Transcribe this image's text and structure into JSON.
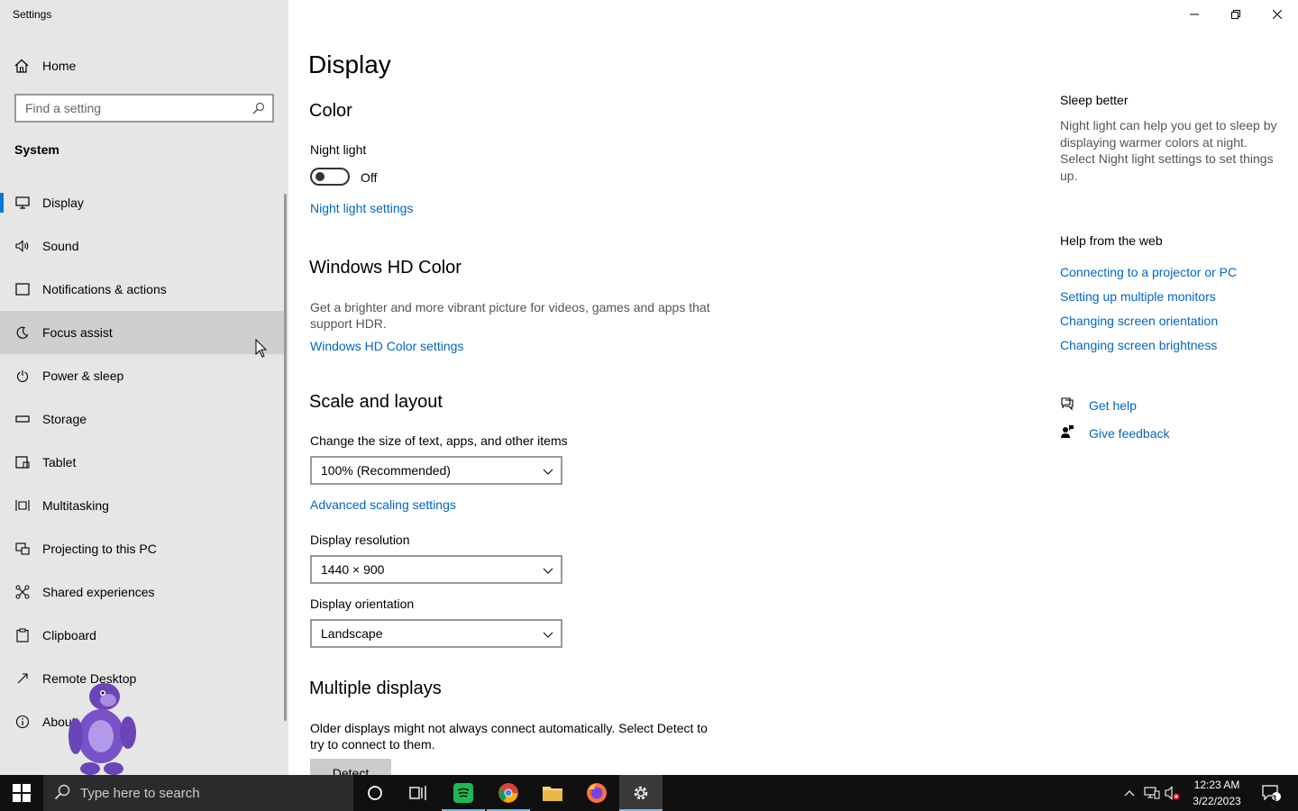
{
  "window": {
    "title": "Settings"
  },
  "sidebar": {
    "home_label": "Home",
    "search_placeholder": "Find a setting",
    "section_title": "System",
    "items": [
      {
        "label": "Display",
        "icon": "monitor-icon"
      },
      {
        "label": "Sound",
        "icon": "speaker-icon"
      },
      {
        "label": "Notifications & actions",
        "icon": "notification-icon"
      },
      {
        "label": "Focus assist",
        "icon": "moon-icon"
      },
      {
        "label": "Power & sleep",
        "icon": "power-icon"
      },
      {
        "label": "Storage",
        "icon": "storage-icon"
      },
      {
        "label": "Tablet",
        "icon": "tablet-icon"
      },
      {
        "label": "Multitasking",
        "icon": "multitasking-icon"
      },
      {
        "label": "Projecting to this PC",
        "icon": "projector-icon"
      },
      {
        "label": "Shared experiences",
        "icon": "shared-icon"
      },
      {
        "label": "Clipboard",
        "icon": "clipboard-icon"
      },
      {
        "label": "Remote Desktop",
        "icon": "remote-icon"
      },
      {
        "label": "About",
        "icon": "info-icon"
      }
    ]
  },
  "main": {
    "page_title": "Display",
    "color": {
      "heading": "Color",
      "night_light_label": "Night light",
      "night_light_state": "Off",
      "night_light_link": "Night light settings"
    },
    "hdr": {
      "heading": "Windows HD Color",
      "description": "Get a brighter and more vibrant picture for videos, games and apps that support HDR.",
      "link": "Windows HD Color settings"
    },
    "scale": {
      "heading": "Scale and layout",
      "size_label": "Change the size of text, apps, and other items",
      "size_value": "100% (Recommended)",
      "advanced_link": "Advanced scaling settings",
      "resolution_label": "Display resolution",
      "resolution_value": "1440 × 900",
      "orientation_label": "Display orientation",
      "orientation_value": "Landscape"
    },
    "multiple": {
      "heading": "Multiple displays",
      "description": "Older displays might not always connect automatically. Select Detect to try to connect to them.",
      "detect_label": "Detect"
    }
  },
  "rail": {
    "sleep_heading": "Sleep better",
    "sleep_desc": "Night light can help you get to sleep by displaying warmer colors at night. Select Night light settings to set things up.",
    "help_heading": "Help from the web",
    "help_links": [
      "Connecting to a projector or PC",
      "Setting up multiple monitors",
      "Changing screen orientation",
      "Changing screen brightness"
    ],
    "get_help": "Get help",
    "give_feedback": "Give feedback"
  },
  "taskbar": {
    "search_placeholder": "Type here to search",
    "time": "12:23 AM",
    "date": "3/22/2023",
    "notification_count": "3"
  },
  "colors": {
    "accent": "#0078d4",
    "link": "#0067c0",
    "sidebar_bg": "#e6e6e6",
    "taskbar_bg": "#101010"
  }
}
